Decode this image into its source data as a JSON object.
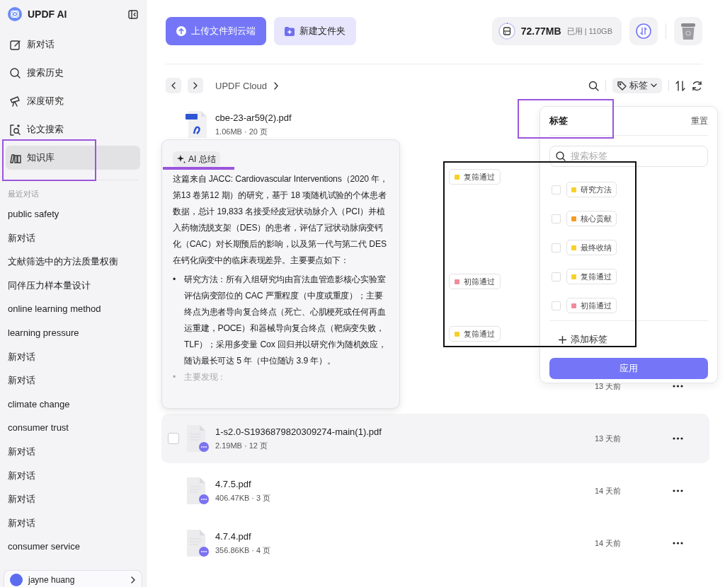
{
  "app": {
    "name": "UPDF AI"
  },
  "sidebar": {
    "nav": [
      {
        "label": "新对话",
        "selected": false
      },
      {
        "label": "搜索历史",
        "selected": false
      },
      {
        "label": "深度研究",
        "selected": false
      },
      {
        "label": "论文搜索",
        "selected": false
      },
      {
        "label": "知识库",
        "selected": true
      }
    ],
    "recent_heading": "最近对话",
    "recent": [
      "public safety",
      "新对话",
      "文献筛选中的方法质量权衡",
      "同伴压力样本量设计",
      "online learning method",
      "learning pressure",
      "新对话",
      "新对话",
      "climate change",
      "consumer trust",
      "新对话",
      "新对话",
      "新对话",
      "新对话",
      "consumer service"
    ],
    "user": {
      "name": "jayne huang"
    }
  },
  "toolbar": {
    "upload": "上传文件到云端",
    "new_folder": "新建文件夹",
    "storage": {
      "used": "72.77MB",
      "detail": "已用 | 110GB"
    }
  },
  "breadcrumb": {
    "path": "UPDF Cloud"
  },
  "filters": {
    "tag_button": "标签"
  },
  "files": [
    {
      "kind": "pdf",
      "name": "cbe-23-ar59(2).pdf",
      "meta": "1.06MB · 20 页",
      "hovered": false
    },
    {
      "kind": "covered",
      "tags": [
        {
          "label": "复筛通过",
          "color": "#f7cf2a"
        }
      ]
    },
    {
      "kind": "covered",
      "tags": [
        {
          "label": "初筛通过",
          "color": "#f28b9a"
        }
      ]
    },
    {
      "kind": "covered",
      "tags": [
        {
          "label": "复筛通过",
          "color": "#f7cf2a"
        }
      ]
    },
    {
      "kind": "covered",
      "date": "13 天前"
    },
    {
      "kind": "document",
      "name": "1-s2.0-S1936879820309274-main(1).pdf",
      "meta": "2.19MB · 12 页",
      "date": "13 天前",
      "hovered": true
    },
    {
      "kind": "document",
      "name": "4.7.5.pdf",
      "meta": "406.47KB · 3 页",
      "date": "14 天前",
      "hovered": false
    },
    {
      "kind": "document",
      "name": "4.7.4.pdf",
      "meta": "356.86KB · 4 页",
      "date": "14 天前",
      "hovered": false
    }
  ],
  "summary": {
    "title": "AI 总结",
    "intro": "这篇来自 JACC: Cardiovascular Interventions（2020 年，第13 卷第12 期）的研究，基于 18 项随机试验的个体患者数据，总计 19,833 名接受经皮冠状动脉介入（PCI）并植入药物洗脱支架（DES）的患者，评估了冠状动脉病变钙化（CAC）对长期预后的影响，以及第一代与第二代 DES 在钙化病变中的临床表现差异。主要要点如下：",
    "bullets": [
      {
        "marker": "•",
        "text": "研究方法：所有入组研究均由盲法血管造影核心实验室评估病变部位的 CAC 严重程度（中度或重度）；主要终点为患者导向复合终点（死亡、心肌梗死或任何再血运重建，POCE）和器械导向复合终点（靶病变失败，TLF）；采用多变量 Cox 回归并以研究作为随机效应，随访最长可达 5 年（中位随访 3.9 年）。",
        "faded": false
      },
      {
        "marker": "•",
        "text": "主要发现：",
        "faded": true
      }
    ]
  },
  "tag_panel": {
    "title": "标签",
    "reset": "重置",
    "search_placeholder": "搜索标签",
    "tags": [
      {
        "label": "研究方法",
        "color": "#f7cf2a",
        "checked": false
      },
      {
        "label": "核心贡献",
        "color": "#f59a23",
        "checked": false
      },
      {
        "label": "最终收纳",
        "color": "#f7cf2a",
        "checked": false
      },
      {
        "label": "复筛通过",
        "color": "#f7cf2a",
        "checked": false
      },
      {
        "label": "初筛通过",
        "color": "#f28b9a",
        "checked": false
      }
    ],
    "add": "添加标签",
    "apply": "应用"
  },
  "annotations": [
    {
      "kind": "box",
      "color": "#9b55dd"
    },
    {
      "kind": "box",
      "color": "#9b55dd"
    },
    {
      "kind": "underline",
      "color": "#9b55dd"
    },
    {
      "kind": "box",
      "color": "#111111"
    }
  ]
}
